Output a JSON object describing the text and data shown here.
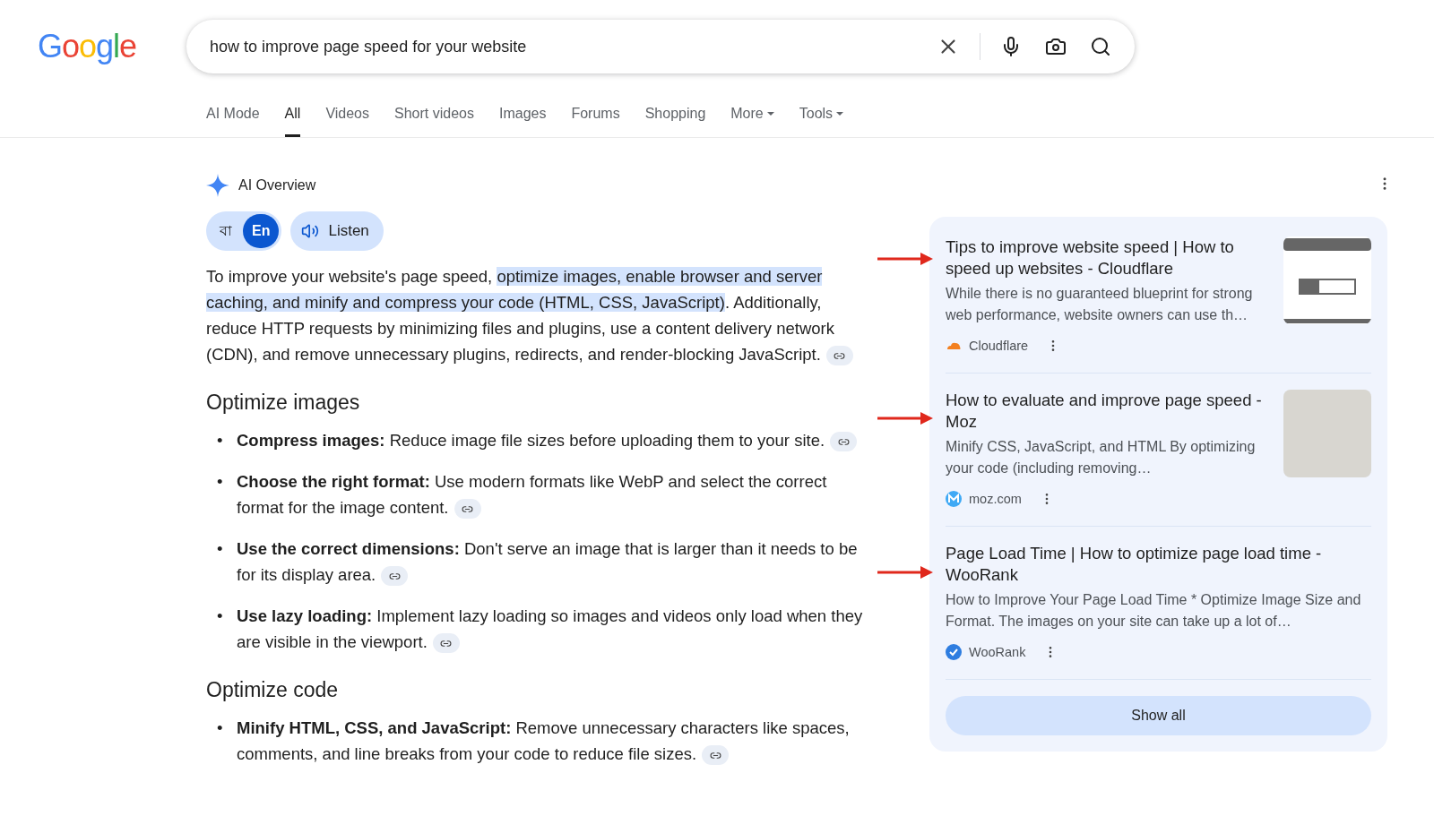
{
  "logo": "Google",
  "search": {
    "value": "how to improve page speed for your website"
  },
  "tabs": [
    {
      "label": "AI Mode",
      "selected": false,
      "dropdown": false
    },
    {
      "label": "All",
      "selected": true,
      "dropdown": false
    },
    {
      "label": "Videos",
      "selected": false,
      "dropdown": false
    },
    {
      "label": "Short videos",
      "selected": false,
      "dropdown": false
    },
    {
      "label": "Images",
      "selected": false,
      "dropdown": false
    },
    {
      "label": "Forums",
      "selected": false,
      "dropdown": false
    },
    {
      "label": "Shopping",
      "selected": false,
      "dropdown": false
    },
    {
      "label": "More",
      "selected": false,
      "dropdown": true
    },
    {
      "label": "Tools",
      "selected": false,
      "dropdown": true
    }
  ],
  "overview": {
    "title": "AI Overview",
    "languages": [
      {
        "label": "বা",
        "selected": false
      },
      {
        "label": "En",
        "selected": true
      }
    ],
    "listen": "Listen",
    "intro": [
      {
        "text": "To improve your website's page speed, ",
        "highlighted": false
      },
      {
        "text": "optimize images, enable browser and server caching, and minify and compress your code (HTML, CSS, JavaScript)",
        "highlighted": true
      },
      {
        "text": ". Additionally, reduce HTTP requests by minimizing files and plugins, use a content delivery network (CDN), and remove unnecessary plugins, redirects, and render-blocking JavaScript.",
        "highlighted": false
      }
    ],
    "sections": [
      {
        "heading": "Optimize images",
        "bullets": [
          {
            "marker": "•",
            "lead": "Compress images:",
            "text": "Reduce image file sizes before uploading them to your site."
          },
          {
            "marker": "•",
            "lead": "Choose the right format:",
            "text": "Use modern formats like WebP and select the correct format for the image content."
          },
          {
            "marker": "•",
            "lead": "Use the correct dimensions:",
            "text": "Don't serve an image that is larger than it needs to be for its display area."
          },
          {
            "marker": "•",
            "lead": "Use lazy loading:",
            "text": "Implement lazy loading so images and videos only load when they are visible in the viewport."
          }
        ]
      },
      {
        "heading": "Optimize code",
        "bullets": [
          {
            "marker": "•",
            "lead": "Minify HTML, CSS, and JavaScript:",
            "text": "Remove unnecessary characters like spaces, comments, and line breaks from your code to reduce file sizes."
          }
        ]
      }
    ]
  },
  "sources": [
    {
      "title": "Tips to improve website speed | How to speed up websites - Cloudflare",
      "snippet": "While there is no guaranteed blueprint for strong web performance, website owners can use th…",
      "site": "Cloudflare",
      "favicon": {
        "kind": "cloud"
      },
      "thumbnail": {
        "kind": "browser"
      }
    },
    {
      "title": "How to evaluate and improve page speed - Moz",
      "snippet": "Minify CSS, JavaScript, and HTML By optimizing your code (including removing…",
      "site": "moz.com",
      "favicon": {
        "kind": "m"
      },
      "thumbnail": {
        "kind": "photo"
      }
    },
    {
      "title": "Page Load Time | How to optimize page load time - WooRank",
      "snippet": "How to Improve Your Page Load Time * Optimize Image Size and Format. The images on your site can take up a lot of…",
      "site": "WooRank",
      "favicon": {
        "kind": "check"
      }
    }
  ],
  "show_all": "Show all"
}
